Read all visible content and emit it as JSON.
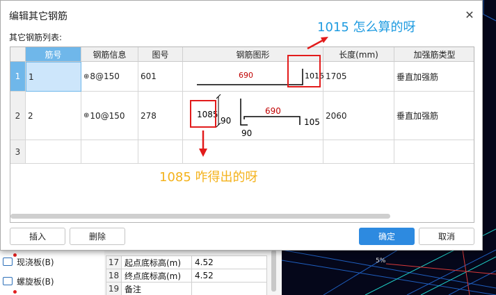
{
  "background": {
    "left_items": [
      "现浇板(B)",
      "螺旋板(B)"
    ],
    "property_rows": [
      {
        "num": "17",
        "name": "起点底标高(m)",
        "value": "4.52"
      },
      {
        "num": "18",
        "name": "终点底标高(m)",
        "value": "4.52"
      },
      {
        "num": "19",
        "name": "备注",
        "value": ""
      }
    ],
    "cad_text": "5%"
  },
  "dialog": {
    "title": "编辑其它钢筋",
    "close_glyph": "✕",
    "list_label": "其它钢筋列表:",
    "columns": [
      "筋号",
      "钢筋信息",
      "图号",
      "钢筋图形",
      "长度(mm)",
      "加强筋类型"
    ],
    "rows": [
      {
        "index": "1",
        "bar_no": "1",
        "symbol": "⊕",
        "info": "8@150",
        "figure_no": "601",
        "shape": {
          "top": "690",
          "right": "1015"
        },
        "length": "1705",
        "type": "垂直加强筋"
      },
      {
        "index": "2",
        "bar_no": "2",
        "symbol": "⊕",
        "info": "10@150",
        "figure_no": "278",
        "shape": {
          "left": "1085",
          "left_vertical": "90",
          "top": "690",
          "bottom": "90",
          "right": "105"
        },
        "length": "2060",
        "type": "垂直加强筋"
      },
      {
        "index": "3",
        "bar_no": "",
        "symbol": "",
        "info": "",
        "figure_no": "",
        "length": "",
        "type": ""
      }
    ],
    "buttons": {
      "insert": "插入",
      "delete": "删除",
      "ok": "确定",
      "cancel": "取消"
    }
  },
  "annotations": {
    "top_note": "1015 怎么算的呀",
    "bottom_note": "1085 咋得出的呀",
    "colors": {
      "top_note": "#1e9be0",
      "bottom_note": "#f4b21b",
      "box": "#e21b1b"
    }
  }
}
